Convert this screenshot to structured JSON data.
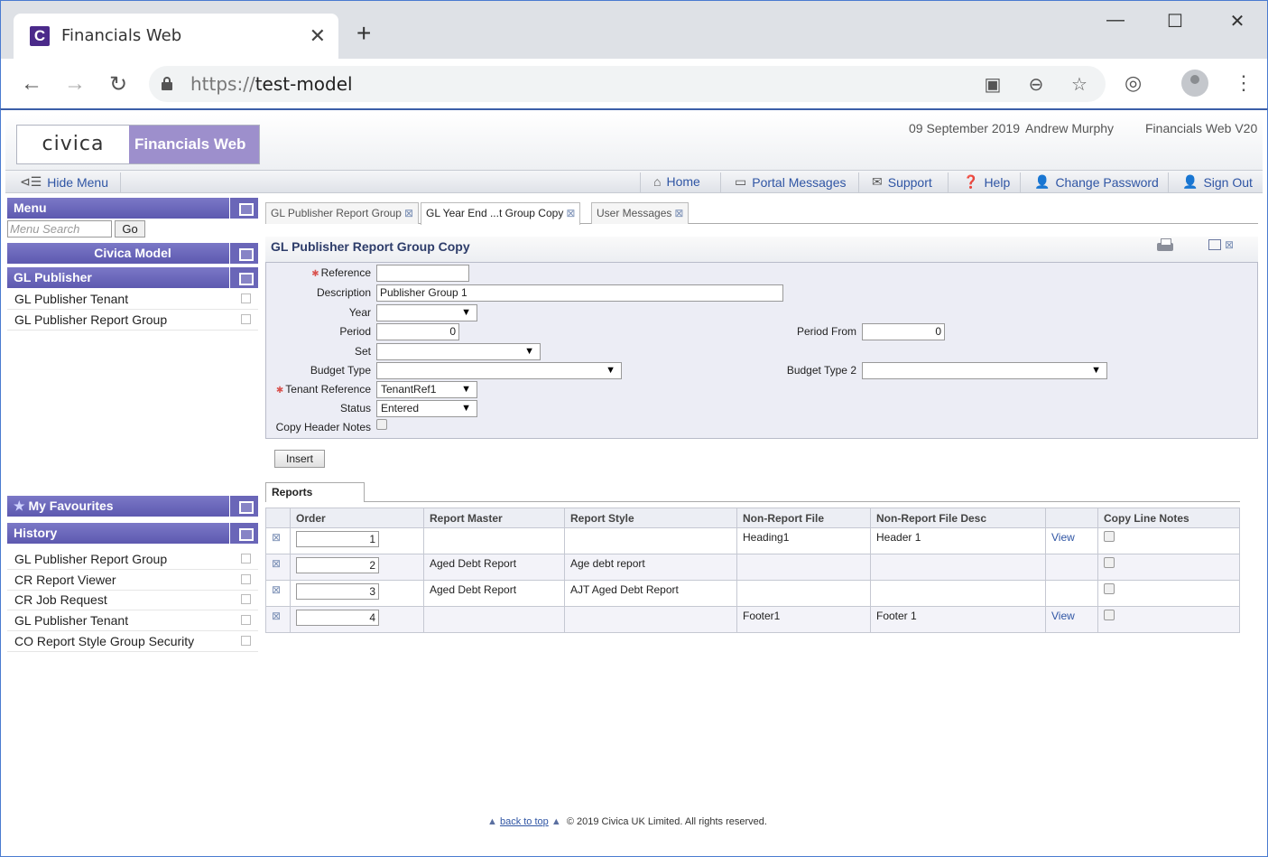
{
  "browser": {
    "tab_title": "Financials Web",
    "favicon_letter": "C",
    "url_scheme": "https://",
    "url_host": "test-model"
  },
  "header": {
    "logo_brand": "civica",
    "logo_app": "Financials Web",
    "date": "09 September 2019",
    "user": "Andrew Murphy",
    "version": "Financials Web V20"
  },
  "navbar": {
    "hide_menu": "Hide Menu",
    "home": "Home",
    "portal_messages": "Portal Messages",
    "support": "Support",
    "help": "Help",
    "change_password": "Change Password",
    "sign_out": "Sign Out"
  },
  "sidebar": {
    "menu_title": "Menu",
    "search_placeholder": "Menu Search",
    "go": "Go",
    "model": "Civica Model",
    "section": "GL Publisher",
    "items": [
      {
        "label": "GL Publisher Tenant"
      },
      {
        "label": "GL Publisher Report Group"
      }
    ],
    "favourites": "My Favourites",
    "history_title": "History",
    "history": [
      {
        "label": "GL Publisher Report Group"
      },
      {
        "label": "CR Report Viewer"
      },
      {
        "label": "CR Job Request"
      },
      {
        "label": "GL Publisher Tenant"
      },
      {
        "label": "CO Report Style Group Security"
      }
    ]
  },
  "tabs": [
    {
      "label": "GL Publisher Report Group",
      "active": false
    },
    {
      "label": "GL Year End ...t Group Copy",
      "active": true
    },
    {
      "label": "User Messages",
      "active": false
    }
  ],
  "form": {
    "title": "GL Publisher Report Group Copy",
    "reference_label": "Reference",
    "reference_value": "",
    "description_label": "Description",
    "description_value": "Publisher Group 1",
    "year_label": "Year",
    "year_value": "",
    "period_label": "Period",
    "period_value": "0",
    "period_from_label": "Period From",
    "period_from_value": "0",
    "set_label": "Set",
    "set_value": "",
    "budget_type_label": "Budget Type",
    "budget_type_value": "",
    "budget_type2_label": "Budget Type 2",
    "budget_type2_value": "",
    "tenant_ref_label": "Tenant Reference",
    "tenant_ref_value": "TenantRef1",
    "status_label": "Status",
    "status_value": "Entered",
    "copy_header_notes_label": "Copy Header Notes",
    "copy_header_notes_checked": false,
    "insert": "Insert"
  },
  "reports": {
    "tab": "Reports",
    "columns": [
      "Order",
      "Report Master",
      "Report Style",
      "Non-Report File",
      "Non-Report File Desc",
      "",
      "Copy Line Notes"
    ],
    "rows": [
      {
        "order": "1",
        "master": "",
        "style": "",
        "file": "Heading1",
        "desc": "Header 1",
        "view": "View",
        "copy": false
      },
      {
        "order": "2",
        "master": "Aged Debt Report",
        "style": "Age debt report",
        "file": "",
        "desc": "",
        "view": "",
        "copy": false
      },
      {
        "order": "3",
        "master": "Aged Debt Report",
        "style": "AJT Aged Debt Report",
        "file": "",
        "desc": "",
        "view": "",
        "copy": false
      },
      {
        "order": "4",
        "master": "",
        "style": "",
        "file": "Footer1",
        "desc": "Footer 1",
        "view": "View",
        "copy": false
      }
    ]
  },
  "footer": {
    "back_to_top": "back to top",
    "copyright": "© 2019 Civica UK Limited. All rights reserved."
  }
}
